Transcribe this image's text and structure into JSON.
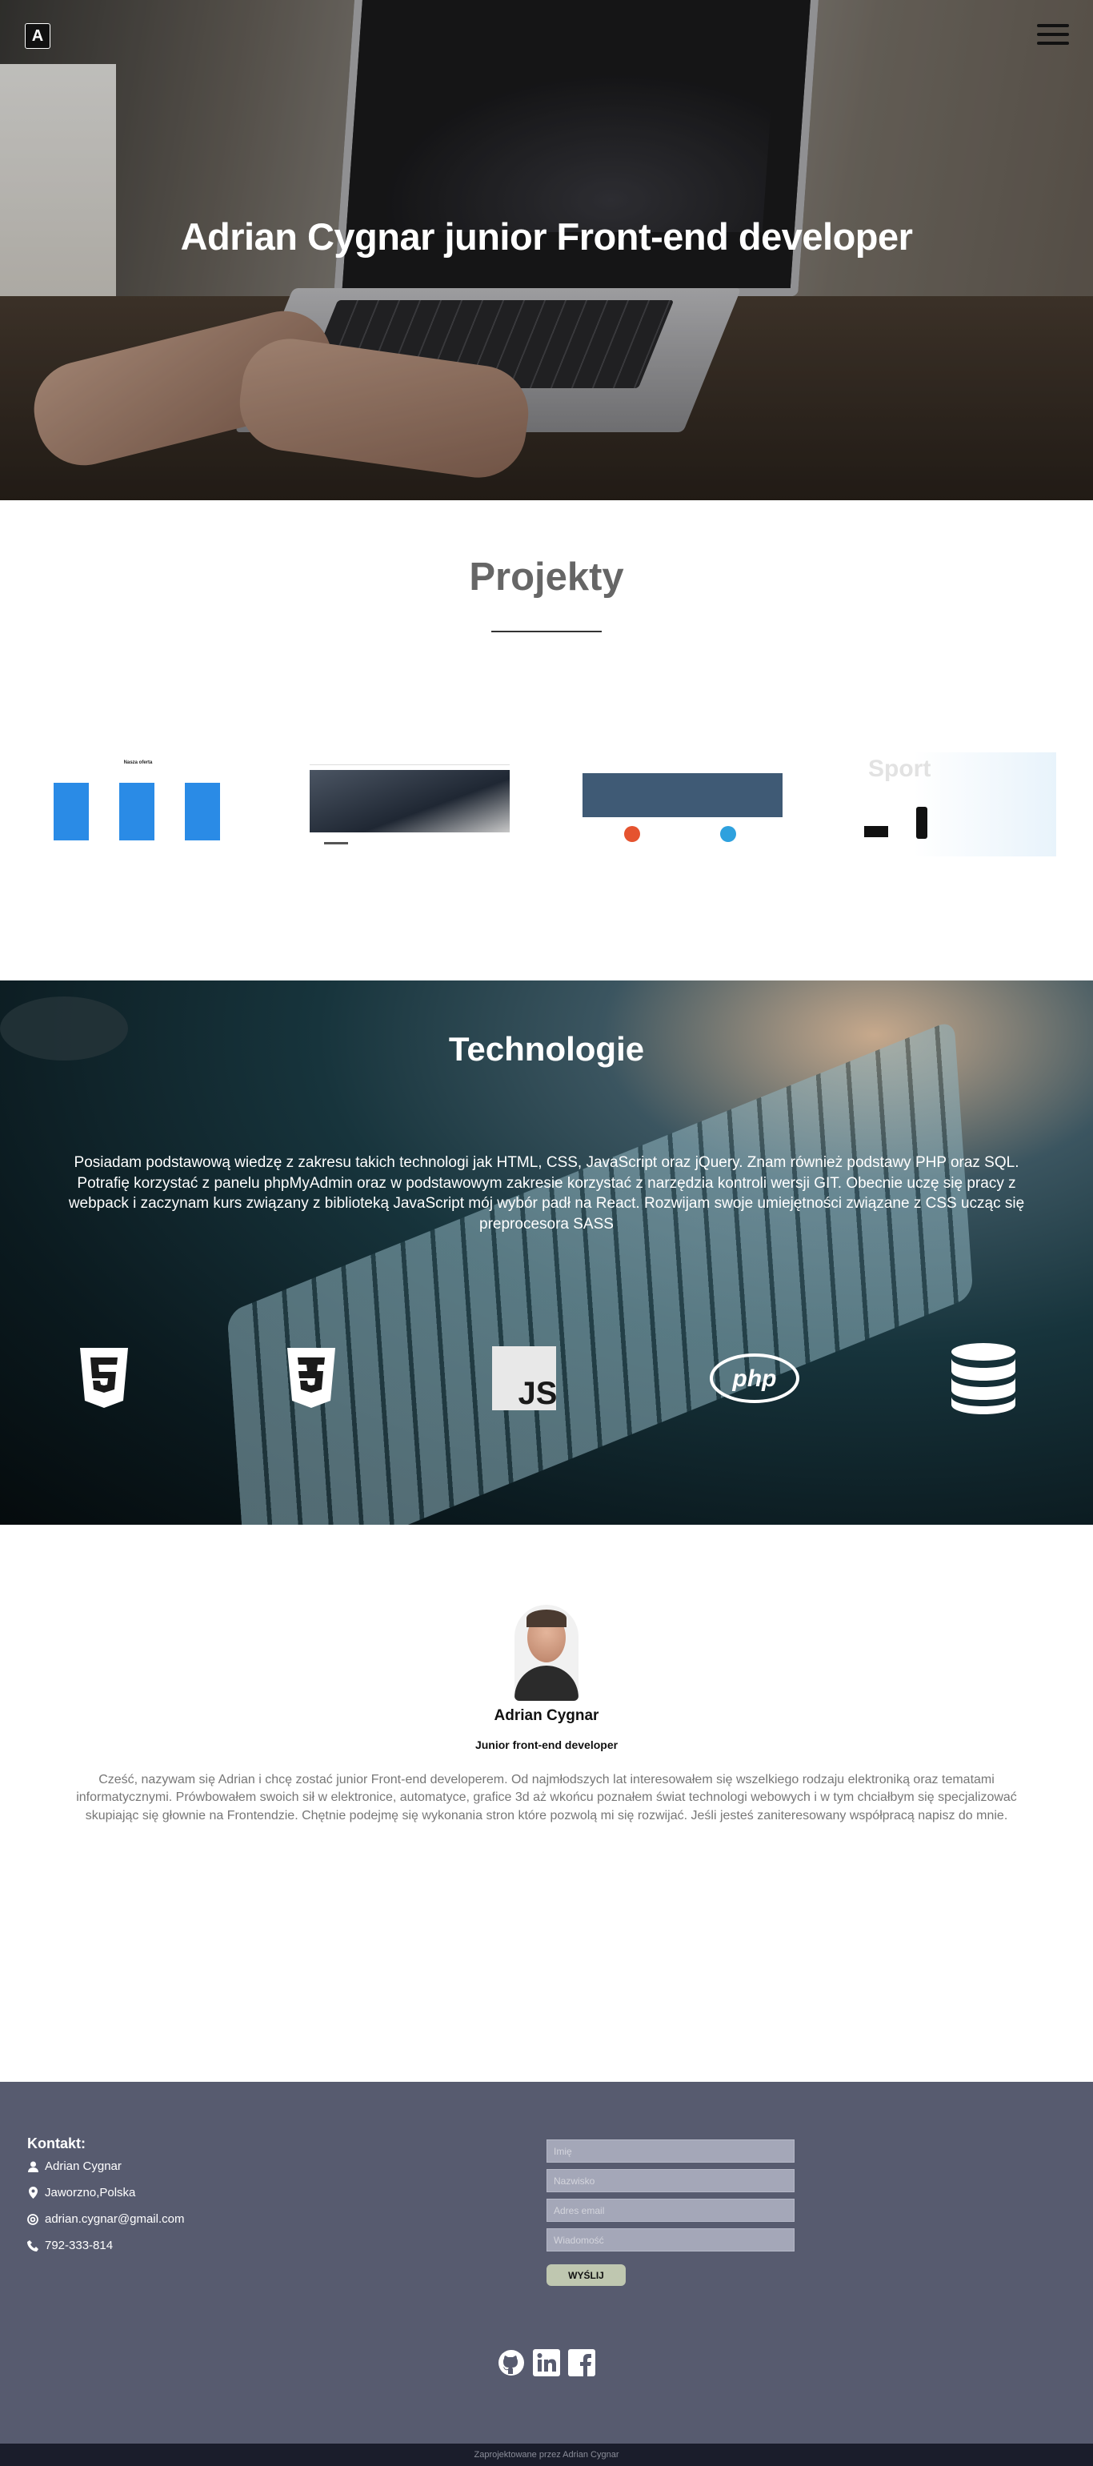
{
  "header": {
    "logo_letter": "A",
    "menu_icon": "hamburger-menu-icon",
    "hero_title": "Adrian Cygnar junior Front-end developer"
  },
  "projects": {
    "title": "Projekty",
    "thumbnails": [
      {
        "caption": "Nasza oferta"
      },
      {
        "caption": ""
      },
      {
        "caption": ""
      },
      {
        "caption": "Sport"
      }
    ]
  },
  "technologies": {
    "title": "Technologie",
    "description": "Posiadam podstawową wiedzę z zakresu takich technologi jak HTML, CSS, JavaScript oraz jQuery. Znam również podstawy PHP oraz SQL. Potrafię korzystać z panelu phpMyAdmin oraz w podstawowym zakresie korzystać z narzędzia kontroli wersji GIT. Obecnie uczę się pracy z webpack i zaczynam kurs związany z biblioteką JavaScript mój wybór padł na React. Rozwijam swoje umiejętności związane z CSS ucząc się preprocesora SASS",
    "icons": [
      "html5-icon",
      "css3-icon",
      "javascript-icon",
      "php-icon",
      "database-icon"
    ],
    "js_label": "JS",
    "php_label": "php"
  },
  "about": {
    "name": "Adrian Cygnar",
    "role": "Junior front-end developer",
    "bio": "Cześć, nazywam się Adrian i chcę zostać junior Front-end developerem. Od najmłodszych lat interesowałem się wszelkiego rodzaju elektroniką oraz tematami informatycznymi. Prówbowałem swoich sił w elektronice, automatyce, grafice 3d aż wkońcu poznałem świat technologi webowych i w tym chciałbym się specjalizować skupiając się głownie na Frontendzie. Chętnie podejmę się wykonania stron które pozwolą mi się rozwijać. Jeśli jesteś zaniteresowany współpracą napisz do mnie."
  },
  "contact": {
    "title": "Kontakt:",
    "name": "Adrian Cygnar",
    "location": "Jaworzno,Polska",
    "email": "adrian.cygnar@gmail.com",
    "phone": "792-333-814",
    "form": {
      "name_placeholder": "Imię",
      "surname_placeholder": "Nazwisko",
      "email_placeholder": "Adres email",
      "message_placeholder": "Wiadomość",
      "send_label": "WYŚLIJ"
    },
    "social_icons": [
      "github-icon",
      "linkedin-icon",
      "facebook-icon"
    ]
  },
  "footer": {
    "credit": "Zaprojektowane przez Adrian Cygnar"
  },
  "colors": {
    "footer_bg": "#575b6f",
    "bottom_bar_bg": "#1a1d2b",
    "send_button": "#bfc7b0",
    "projects_title": "#666666"
  }
}
